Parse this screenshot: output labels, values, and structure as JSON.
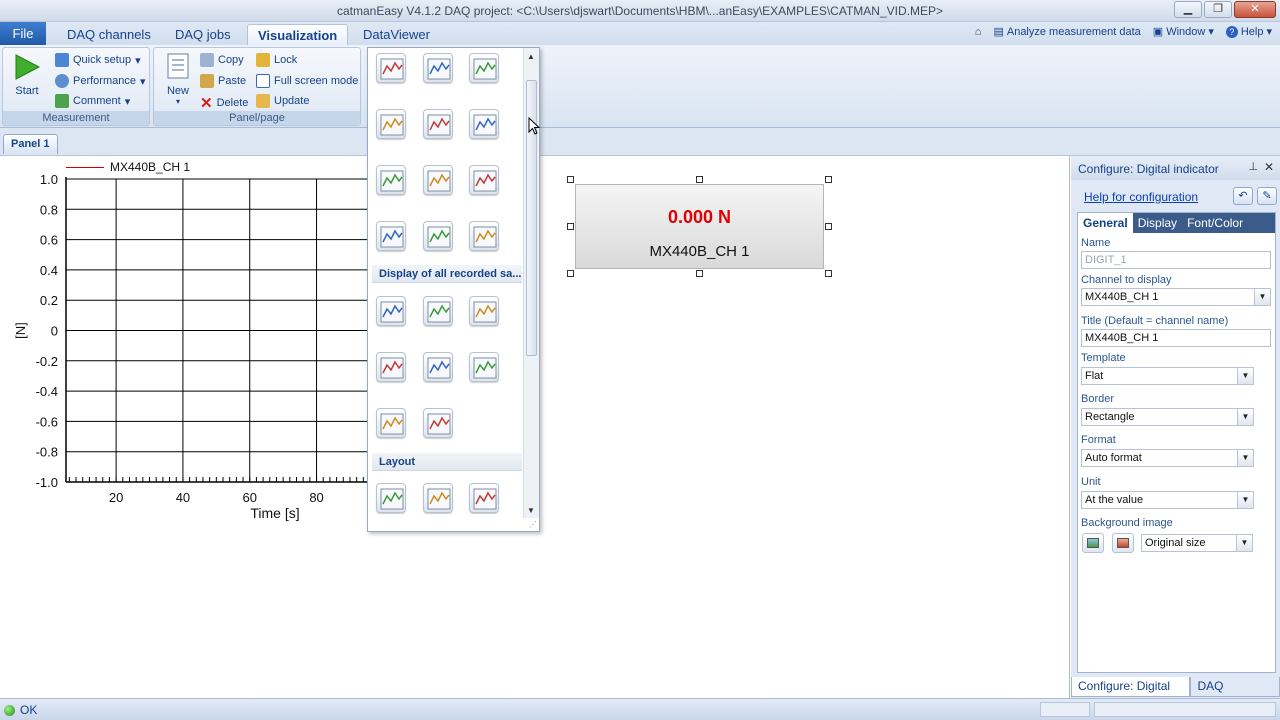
{
  "window": {
    "title": "catmanEasy V4.1.2 DAQ project: <C:\\Users\\djswart\\Documents\\HBM\\...anEasy\\EXAMPLES\\CATMAN_VID.MEP>"
  },
  "menu": {
    "file": "File",
    "tabs": [
      "DAQ channels",
      "DAQ jobs",
      "Visualization",
      "DataViewer"
    ],
    "right": {
      "analyze": "Analyze measurement data",
      "window": "Window",
      "help": "Help"
    }
  },
  "ribbon": {
    "measurement": {
      "label": "Measurement",
      "start": "Start",
      "quick_setup": "Quick setup",
      "performance": "Performance",
      "comment": "Comment"
    },
    "panel_page": {
      "label": "Panel/page",
      "new": "New",
      "copy": "Copy",
      "paste": "Paste",
      "delete": "Delete",
      "lock": "Lock",
      "full_screen": "Full screen mode",
      "update": "Update"
    }
  },
  "panel_tab": "Panel 1",
  "chart_data": {
    "type": "line",
    "series": [
      {
        "name": "MX440B_CH 1",
        "color": "#cc0000",
        "values": []
      }
    ],
    "xlabel": "Time [s]",
    "ylabel": "[N]",
    "x_ticks": [
      20,
      40,
      60,
      80
    ],
    "y_ticks": [
      "1.0",
      "0.8",
      "0.6",
      "0.4",
      "0.2",
      "0",
      "-0.2",
      "-0.4",
      "-0.6",
      "-0.8",
      "-1.0"
    ],
    "ylim": [
      -1.0,
      1.0
    ],
    "grid": true,
    "legend": "top-left"
  },
  "digital_indicator": {
    "value": "0.000 N",
    "channel": "MX440B_CH 1",
    "value_color": "#e00000"
  },
  "gallery": {
    "section1": "Display of all recorded sa...",
    "section2": "Layout",
    "icons_top": [
      "line-chart-icon",
      "numeric-display-icon",
      "text-list-icon",
      "panel-window-icon",
      "analog-meter-icon",
      "bargraph-icon",
      "multi-bar-icon",
      "spectrum-icon",
      "polar-plot-icon",
      "chart-recorder-icon",
      "table-display-icon",
      "led-lamp-icon"
    ],
    "icons_recorded": [
      "area-chart-icon",
      "area-chart-value-icon",
      "polar-plot-icon",
      "waterfall-icon",
      "histogram-icon",
      "alarm-icon",
      "number-table-icon",
      "statistics-icon"
    ],
    "icons_layout": [
      "text-label-icon",
      "image-icon",
      "frame-window-icon"
    ]
  },
  "config": {
    "title": "Configure: Digital indicator",
    "help_link": "Help for configuration",
    "tabs": [
      "General",
      "Display",
      "Font/Color"
    ],
    "name_label": "Name",
    "name_value": "DIGIT_1",
    "channel_label": "Channel to display",
    "channel_value": "MX440B_CH 1",
    "title_label": "Title (Default = channel name)",
    "title_value": "MX440B_CH 1",
    "template_label": "Template",
    "template_value": "Flat",
    "border_label": "Border",
    "border_value": "Rectangle",
    "format_label": "Format",
    "format_value": "Auto format",
    "unit_label": "Unit",
    "unit_value": "At the value",
    "bg_label": "Background image",
    "bg_value": "Original size",
    "bottom_tabs": [
      "Configure: Digital i...",
      "DAQ channels"
    ]
  },
  "status": {
    "text": "OK"
  }
}
